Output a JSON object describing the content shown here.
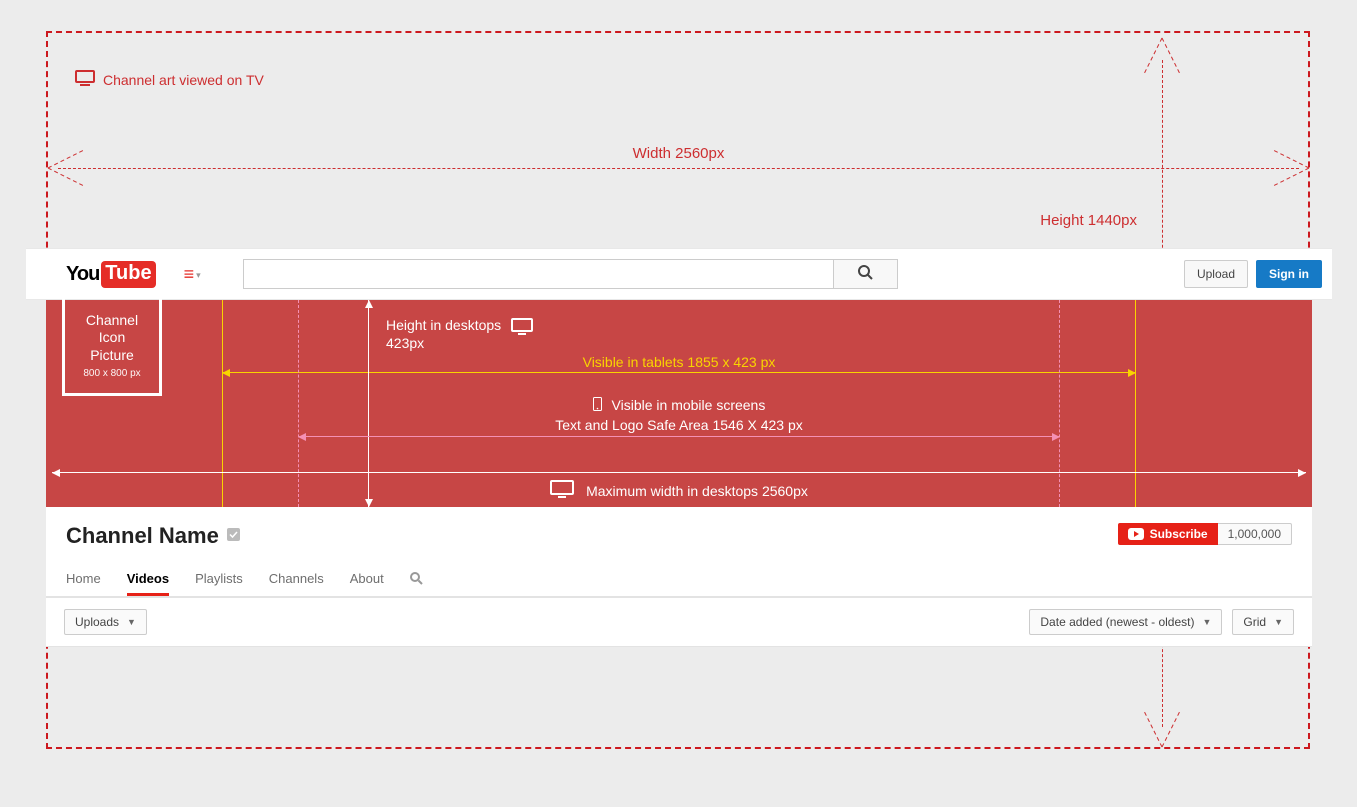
{
  "tv_label": "Channel art viewed on TV",
  "width_label": "Width  2560px",
  "height_label": "Height   1440px",
  "icon_box": {
    "line1": "Channel",
    "line2": "Icon",
    "line3": "Picture",
    "dims": "800 x 800 px"
  },
  "desktop_height": {
    "line1": "Height in desktops",
    "line2": "423px"
  },
  "tablet_label": "Visible in tablets  1855 x 423 px",
  "mobile": {
    "line1": "Visible in mobile screens",
    "line2": "Text and Logo Safe Area   1546 X 423 px"
  },
  "max_width_label": "Maximum width in desktops  2560px",
  "topbar": {
    "search_placeholder": "",
    "upload": "Upload",
    "signin": "Sign in"
  },
  "channel": {
    "name": "Channel Name",
    "subscribe": "Subscribe",
    "sub_count": "1,000,000"
  },
  "tabs": {
    "home": "Home",
    "videos": "Videos",
    "playlists": "Playlists",
    "channels": "Channels",
    "about": "About"
  },
  "toolbar": {
    "uploads": "Uploads",
    "sort": "Date added (newest - oldest)",
    "view": "Grid"
  }
}
